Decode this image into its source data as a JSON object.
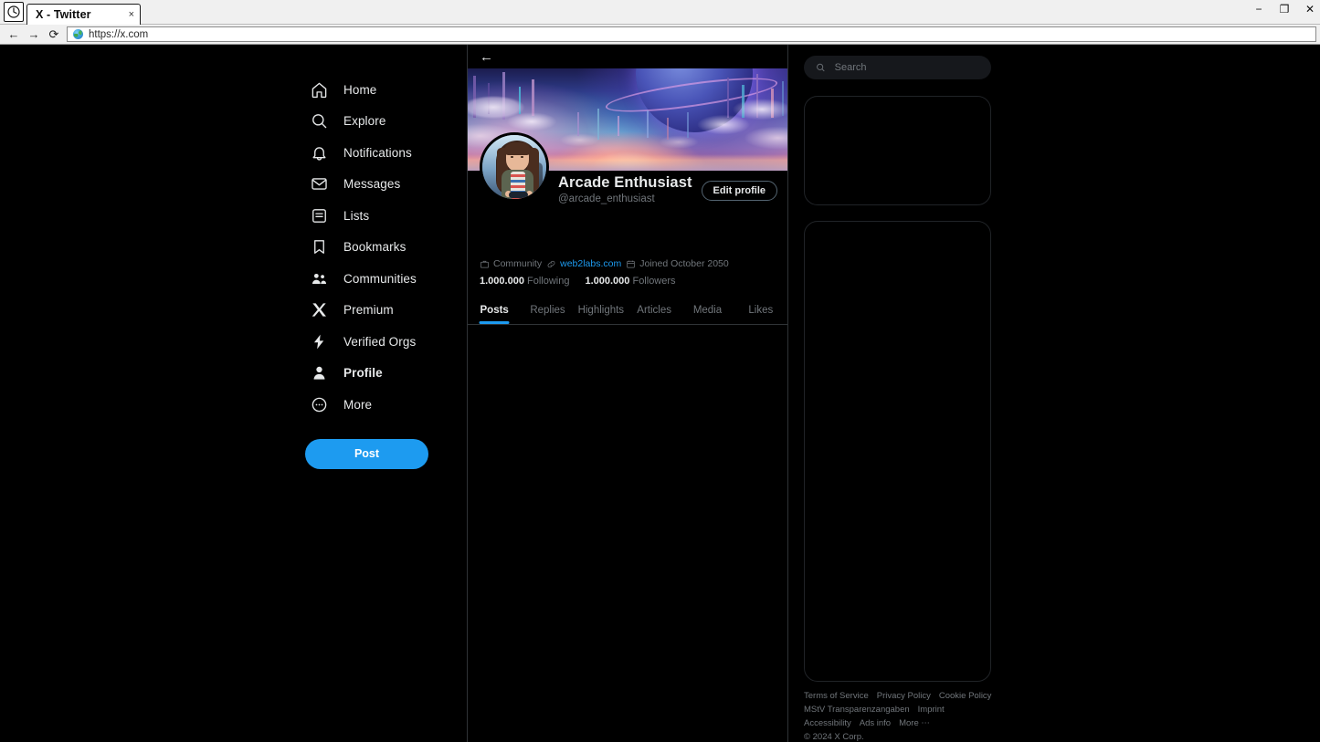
{
  "browser": {
    "tab_title": "X - Twitter",
    "tab_close": "×",
    "url": "https://x.com",
    "back_icon": "←",
    "forward_icon": "→",
    "reload_icon": "⟳",
    "minimize": "−",
    "maximize": "❐",
    "close": "✕"
  },
  "sidebar": {
    "items": [
      {
        "label": "Home",
        "icon": "home-icon",
        "active": false
      },
      {
        "label": "Explore",
        "icon": "search-icon",
        "active": false
      },
      {
        "label": "Notifications",
        "icon": "bell-icon",
        "active": false
      },
      {
        "label": "Messages",
        "icon": "envelope-icon",
        "active": false
      },
      {
        "label": "Lists",
        "icon": "list-icon",
        "active": false
      },
      {
        "label": "Bookmarks",
        "icon": "bookmark-icon",
        "active": false
      },
      {
        "label": "Communities",
        "icon": "communities-icon",
        "active": false
      },
      {
        "label": "Premium",
        "icon": "x-logo-icon",
        "active": false
      },
      {
        "label": "Verified Orgs",
        "icon": "lightning-icon",
        "active": false
      },
      {
        "label": "Profile",
        "icon": "person-icon",
        "active": true
      },
      {
        "label": "More",
        "icon": "more-circle-icon",
        "active": false
      }
    ],
    "post_button": "Post"
  },
  "profile": {
    "back_arrow": "←",
    "display_name": "Arcade Enthusiast",
    "handle": "@arcade_enthusiast",
    "edit_button": "Edit profile",
    "meta": {
      "community": "Community",
      "website": "web2labs.com",
      "joined": "Joined October 2050"
    },
    "stats": {
      "following_count": "1.000.000",
      "following_label": "Following",
      "followers_count": "1.000.000",
      "followers_label": "Followers"
    },
    "tabs": [
      {
        "label": "Posts",
        "active": true
      },
      {
        "label": "Replies",
        "active": false
      },
      {
        "label": "Highlights",
        "active": false
      },
      {
        "label": "Articles",
        "active": false
      },
      {
        "label": "Media",
        "active": false
      },
      {
        "label": "Likes",
        "active": false
      }
    ]
  },
  "right_panel": {
    "search_placeholder": "Search",
    "footer_links": [
      "Terms of Service",
      "Privacy Policy",
      "Cookie Policy",
      "MStV Transparenzangaben",
      "Imprint",
      "Accessibility",
      "Ads info",
      "More ⋯",
      "© 2024 X Corp."
    ]
  },
  "colors": {
    "accent": "#1d9bf0",
    "background": "#000000",
    "text_primary": "#e7e9ea",
    "text_secondary": "#71767b",
    "border": "#2f3336"
  }
}
